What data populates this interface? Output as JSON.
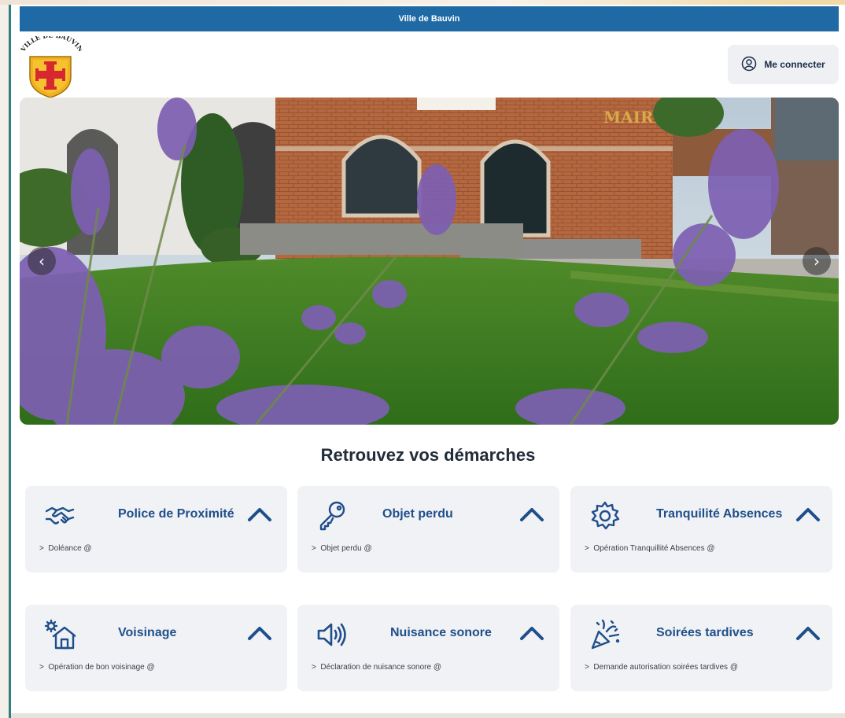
{
  "header": {
    "city_name": "Ville de Bauvin"
  },
  "logo": {
    "text": "VILLE DE BAUVIN",
    "icon": "coat-of-arms"
  },
  "login": {
    "label": "Me connecter",
    "icon": "user-circle-icon"
  },
  "hero": {
    "sign_text": "MAIRIE",
    "prev_label": "‹",
    "next_label": "›"
  },
  "section": {
    "title": "Retrouvez vos démarches"
  },
  "cards": [
    {
      "title": "Police de Proximité",
      "link": "Doléance @",
      "icon": "handshake-icon"
    },
    {
      "title": "Objet perdu",
      "link": "Objet perdu @",
      "icon": "key-icon"
    },
    {
      "title": "Tranquilité Absences",
      "link": "Opération Tranquillité Absences @",
      "icon": "gear-icon"
    },
    {
      "title": "Voisinage",
      "link": "Opération de bon voisinage @",
      "icon": "house-gear-icon"
    },
    {
      "title": "Nuisance sonore",
      "link": "Déclaration de nuisance sonore @",
      "icon": "speaker-icon"
    },
    {
      "title": "Soirées tardives",
      "link": "Demande autorisation soirées tardives @",
      "icon": "party-popper-icon"
    }
  ],
  "link_prefix": ">",
  "colors": {
    "topbar": "#1f6aa5",
    "card_title": "#1f4f8a",
    "card_bg": "#f1f2f5"
  }
}
